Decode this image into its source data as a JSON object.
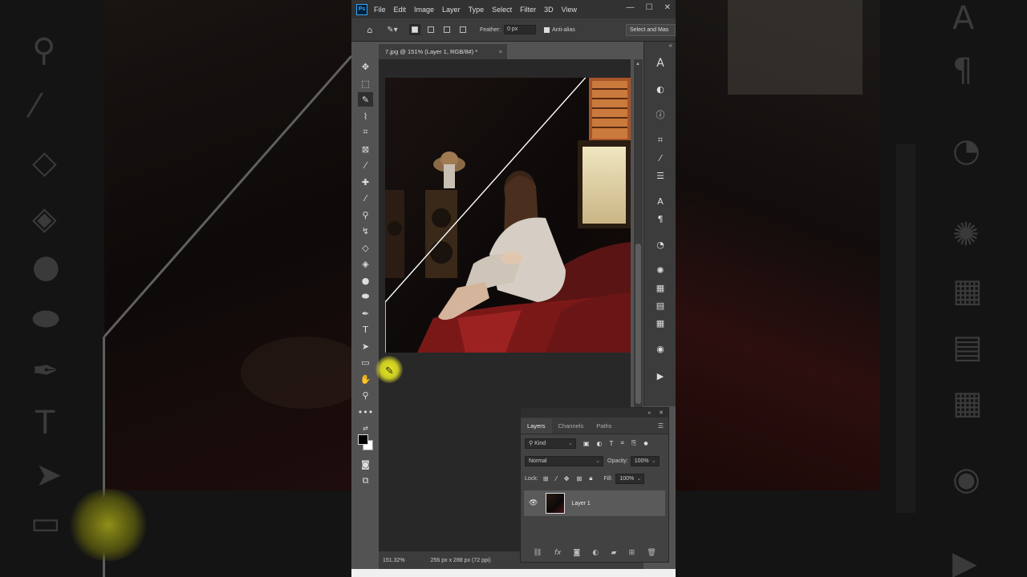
{
  "app": {
    "name": "Adobe Photoshop",
    "logo": "Ps"
  },
  "menu": [
    "File",
    "Edit",
    "Image",
    "Layer",
    "Type",
    "Select",
    "Filter",
    "3D",
    "View"
  ],
  "window_controls": [
    "—",
    "☐",
    "✕"
  ],
  "options_bar": {
    "feather_label": "Feather:",
    "feather_value": "0 px",
    "antialias_label": "Anti-alias",
    "antialias_checked": true,
    "select_mask_label": "Select and Mas"
  },
  "document_tab": {
    "title": "7.jpg @ 151% (Layer 1, RGB/8#) *",
    "close": "×"
  },
  "status": {
    "zoom": "151.32%",
    "doc_info": "256 px x 288 px (72 ppi)"
  },
  "tools": [
    "move",
    "marquee",
    "polygonal-lasso",
    "quick-select",
    "crop",
    "frame",
    "eyedropper",
    "healing",
    "brush",
    "clone-stamp",
    "history-brush",
    "eraser",
    "paint-bucket",
    "blur",
    "dodge",
    "pen",
    "type",
    "path-select",
    "rectangle",
    "hand",
    "zoom",
    "more",
    "default-colors",
    "swap-colors",
    "foreground",
    "background",
    "quick-mask",
    "screen-mode"
  ],
  "active_tool": "polygonal-lasso",
  "layers_panel": {
    "tabs": [
      "Layers",
      "Channels",
      "Paths"
    ],
    "active_tab": "Layers",
    "filter_kind": "Kind",
    "blend_mode": "Normal",
    "opacity_label": "Opacity:",
    "opacity_value": "100%",
    "lock_label": "Lock:",
    "fill_label": "Fill:",
    "fill_value": "100%",
    "layers": [
      {
        "name": "Layer 1",
        "visible": true
      }
    ],
    "collapse": "«",
    "close": "✕"
  },
  "colors": {
    "accent": "#31a8ff",
    "ui_dark": "#323232",
    "ui_mid": "#535353",
    "sofa_red": "#8b1a1a"
  }
}
